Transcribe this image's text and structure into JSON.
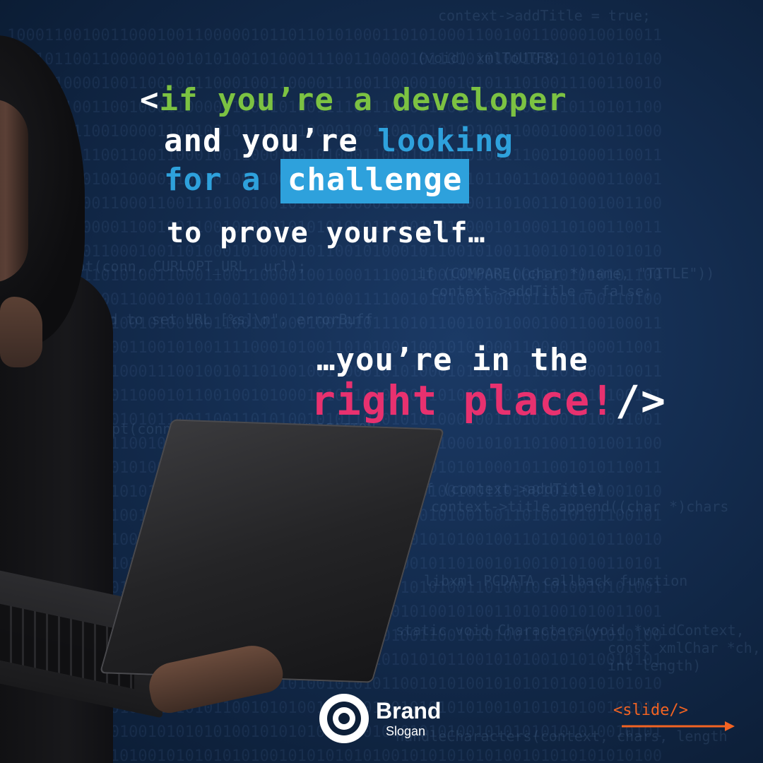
{
  "headline": {
    "line1": {
      "open": "<",
      "text": "if you’re a developer"
    },
    "line2": {
      "prefix": "and you’re ",
      "accent": "looking"
    },
    "line3": {
      "prefix": "for a ",
      "highlight": "challenge"
    },
    "line4": "to prove yourself…",
    "line5": "…you’re in the",
    "line6": {
      "accent": "right place!",
      "close": "/>"
    }
  },
  "brand": {
    "name": "Brand",
    "slogan": "Slogan"
  },
  "nav": {
    "slide_label": "<slide/>"
  },
  "colors": {
    "background": "#132b4d",
    "green": "#7cc242",
    "blue": "#2ea1dc",
    "pink": "#e8316f",
    "orange": "#f26322",
    "white": "#ffffff"
  }
}
